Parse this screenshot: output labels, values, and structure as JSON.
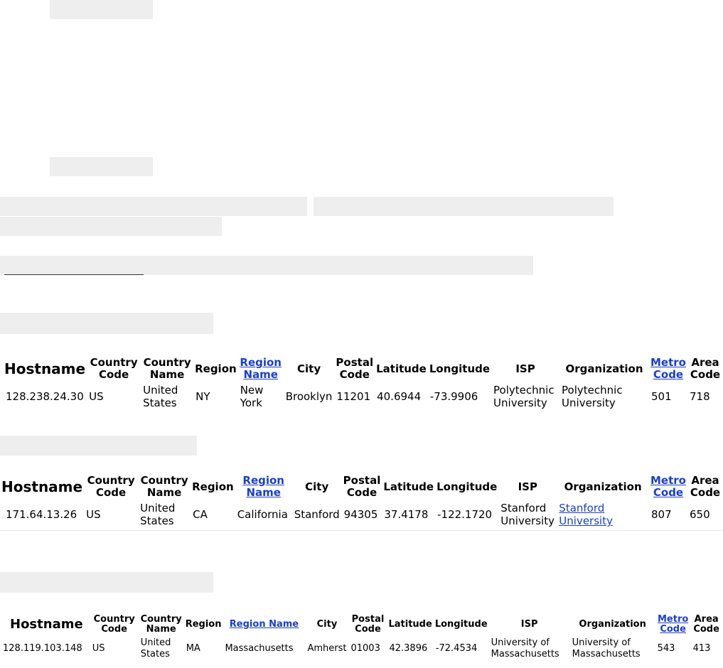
{
  "hidden_text_bars": "redacted",
  "tables": [
    {
      "headers": [
        "Hostname",
        "Country Code",
        "Country Name",
        "Region",
        "Region Name",
        "City",
        "Postal Code",
        "Latitude",
        "Longitude",
        "ISP",
        "Organization",
        "Metro Code",
        "Area Code"
      ],
      "header_links": [
        "Region Name",
        "Metro Code"
      ],
      "row": {
        "hostname": "128.238.24.30",
        "country_code": "US",
        "country_name": "United States",
        "region": "NY",
        "region_name": "New York",
        "city": "Brooklyn",
        "postal_code": "11201",
        "latitude": "40.6944",
        "longitude": "-73.9906",
        "isp": "Polytechnic University",
        "organization": "Polytechnic University",
        "metro_code": "501",
        "area_code": "718"
      }
    },
    {
      "headers": [
        "Hostname",
        "Country Code",
        "Country Name",
        "Region",
        "Region Name",
        "City",
        "Postal Code",
        "Latitude",
        "Longitude",
        "ISP",
        "Organization",
        "Metro Code",
        "Area Code"
      ],
      "header_links": [
        "Region Name",
        "Metro Code"
      ],
      "row": {
        "hostname": "171.64.13.26",
        "country_code": "US",
        "country_name": "United States",
        "region": "CA",
        "region_name": "California",
        "city": "Stanford",
        "postal_code": "94305",
        "latitude": "37.4178",
        "longitude": "-122.1720",
        "isp": "Stanford University",
        "organization": "Stanford University",
        "metro_code": "807",
        "area_code": "650"
      }
    },
    {
      "headers": [
        "Hostname",
        "Country Code",
        "Country Name",
        "Region",
        "Region Name",
        "City",
        "Postal Code",
        "Latitude",
        "Longitude",
        "ISP",
        "Organization",
        "Metro Code",
        "Area Code"
      ],
      "header_links": [
        "Region Name",
        "Metro Code"
      ],
      "row": {
        "hostname": "128.119.103.148",
        "country_code": "US",
        "country_name": "United States",
        "region": "MA",
        "region_name": "Massachusetts",
        "city": "Amherst",
        "postal_code": "01003",
        "latitude": "42.3896",
        "longitude": "-72.4534",
        "isp": "University of Massachusetts",
        "organization": "University of Massachusetts",
        "metro_code": "543",
        "area_code": "413"
      }
    }
  ]
}
